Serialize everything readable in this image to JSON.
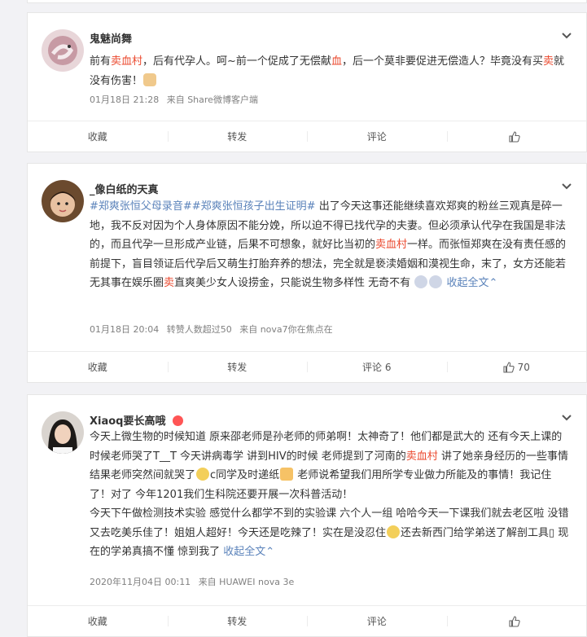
{
  "posts": [
    {
      "name": "鬼魅尚舞",
      "text_runs": [
        {
          "t": "前有",
          "c": ""
        },
        {
          "t": "卖血村",
          "c": "red"
        },
        {
          "t": "，后有代孕人。呵~前一个促成了无偿献",
          "c": ""
        },
        {
          "t": "血",
          "c": "red"
        },
        {
          "t": "，后一个莫非要促进无偿造人？毕竟没有买",
          "c": ""
        },
        {
          "t": "卖",
          "c": "red"
        },
        {
          "t": "就没有伤害！",
          "c": ""
        }
      ],
      "emoji": [
        "cat-emoji"
      ],
      "meta_time": "01月18日 21:28",
      "meta_source": "来自 Share微博客户端",
      "meta_extra": "",
      "actions": {
        "collect": "收藏",
        "repost": "转发",
        "comment": "评论",
        "like": ""
      }
    },
    {
      "name": "_像白纸的天真",
      "text_runs": [
        {
          "t": "#郑爽张恒父母录音##郑爽张恒孩子出生证明#",
          "c": "blue"
        },
        {
          "t": " 出了今天这事还能继续喜欢郑爽的粉丝三观真是碎一地，我不反对因为个人身体原因不能分娩，所以迫不得已找代孕的夫妻。但必须承认代孕在我国是非法的，而且代孕一旦形成产业链，后果不可想象，就好比当初的",
          "c": ""
        },
        {
          "t": "卖血村",
          "c": "red"
        },
        {
          "t": "一样。而张恒郑爽在没有责任感的前提下，盲目领证后代孕后又萌生打胎弃养的想法，完全就是亵渎婚姻和漠视生命，末了，女方还能若无其事在娱乐圈",
          "c": ""
        },
        {
          "t": "卖",
          "c": "red"
        },
        {
          "t": "直爽美少女人设捞金，只能说生物多样性 无奇不有",
          "c": ""
        }
      ],
      "collapse": "收起全文",
      "meta_time": "01月18日 20:04",
      "meta_source": "来自 nova7你在焦点在",
      "meta_extra": "转赞人数超过50",
      "actions": {
        "collect": "收藏",
        "repost": "转发",
        "comment": "评论 6",
        "like": "70"
      }
    },
    {
      "name": "Xiaoq要长高哦",
      "text_runs": [
        {
          "t": "今天上微生物的时候知道 原来邵老师是孙老师的师弟啊！太神奇了！他们都是武大的 还有今天上课的时候老师哭了T__T 今天讲病毒学 讲到HIV的时候 老师提到了河南的",
          "c": ""
        },
        {
          "t": "卖血村",
          "c": "red"
        },
        {
          "t": " 讲了她亲身经历的一些事情 结果老师突然间就哭了",
          "c": ""
        },
        {
          "t": "[emoji]",
          "c": "emoji"
        },
        {
          "t": "c同学及时递纸",
          "c": ""
        },
        {
          "t": "[emoji2]",
          "c": "emoji2"
        },
        {
          "t": " 老师说希望我们用所学专业做力所能及的事情！我记住了！对了 今年1201我们生科院还要开展一次科普活动！",
          "c": ""
        },
        {
          "t": "[br]",
          "c": "br"
        },
        {
          "t": "今天下午做检测技术实验 感觉什么都学不到的实验课 六个人一组 哈哈今天一下课我们就去老区啦 没错又去吃美乐佳了！姐姐人超好！今天还是吃辣了！实在是没忍住",
          "c": ""
        },
        {
          "t": "[emoji]",
          "c": "emoji"
        },
        {
          "t": "还去新西门给学弟送了解剖工具▯ 现在的学弟真搞不懂 惊到我了 ",
          "c": ""
        }
      ],
      "collapse": "收起全文",
      "meta_time": "2020年11月04日 00:11",
      "meta_source": "来自 HUAWEI nova 3e",
      "meta_extra": "",
      "actions": {
        "collect": "收藏",
        "repost": "转发",
        "comment": "评论",
        "like": ""
      }
    }
  ]
}
